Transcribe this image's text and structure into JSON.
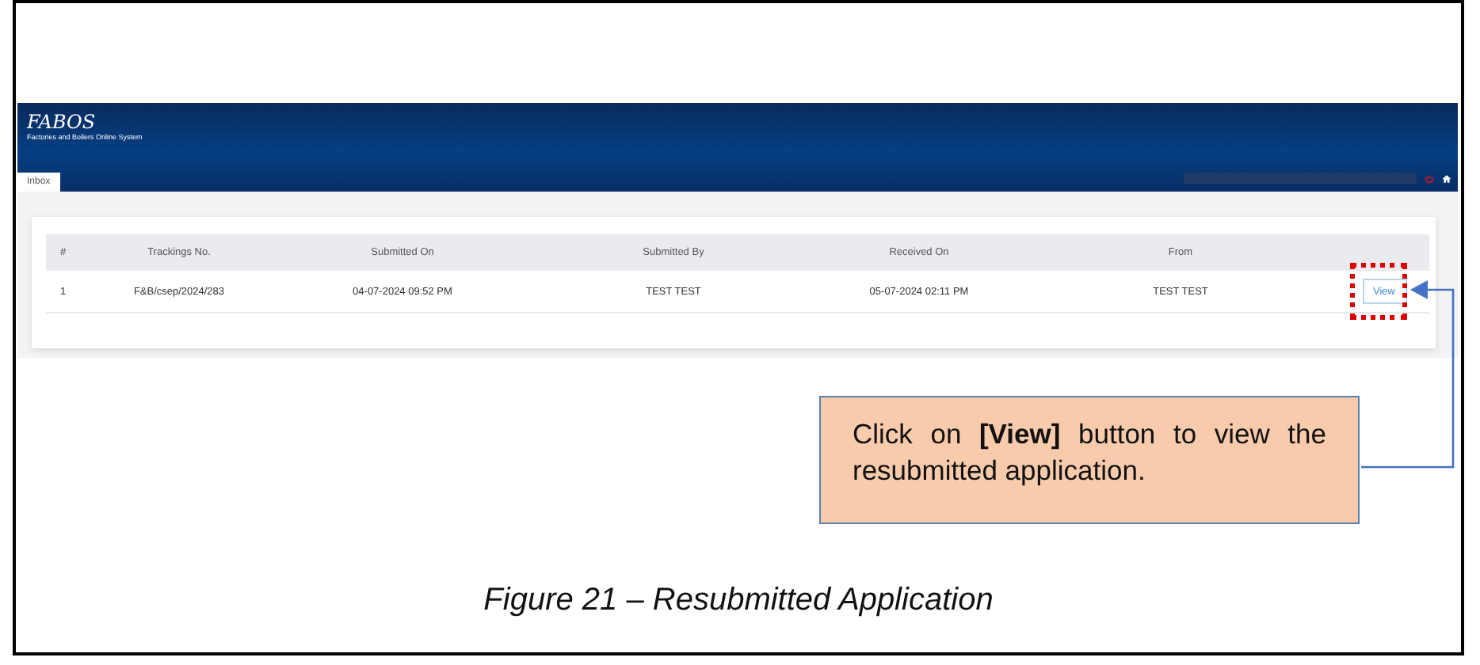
{
  "app": {
    "logo": "FABOS",
    "subtitle": "Factories and Boilers Online System"
  },
  "tabs": [
    {
      "label": "Inbox",
      "selected": true
    }
  ],
  "table": {
    "columns": [
      "#",
      "Trackings No.",
      "Submitted On",
      "Submitted By",
      "Received On",
      "From"
    ],
    "rows": [
      {
        "cells": [
          "1",
          "F&B/csep/2024/283",
          "04-07-2024 09:52 PM",
          "TEST TEST",
          "05-07-2024 02:11 PM",
          "TEST TEST"
        ],
        "action": "View"
      }
    ]
  },
  "callout": {
    "text": "Click on **[View]** button to view the resubmitted application."
  },
  "caption": "Figure 21 – Resubmitted Application"
}
